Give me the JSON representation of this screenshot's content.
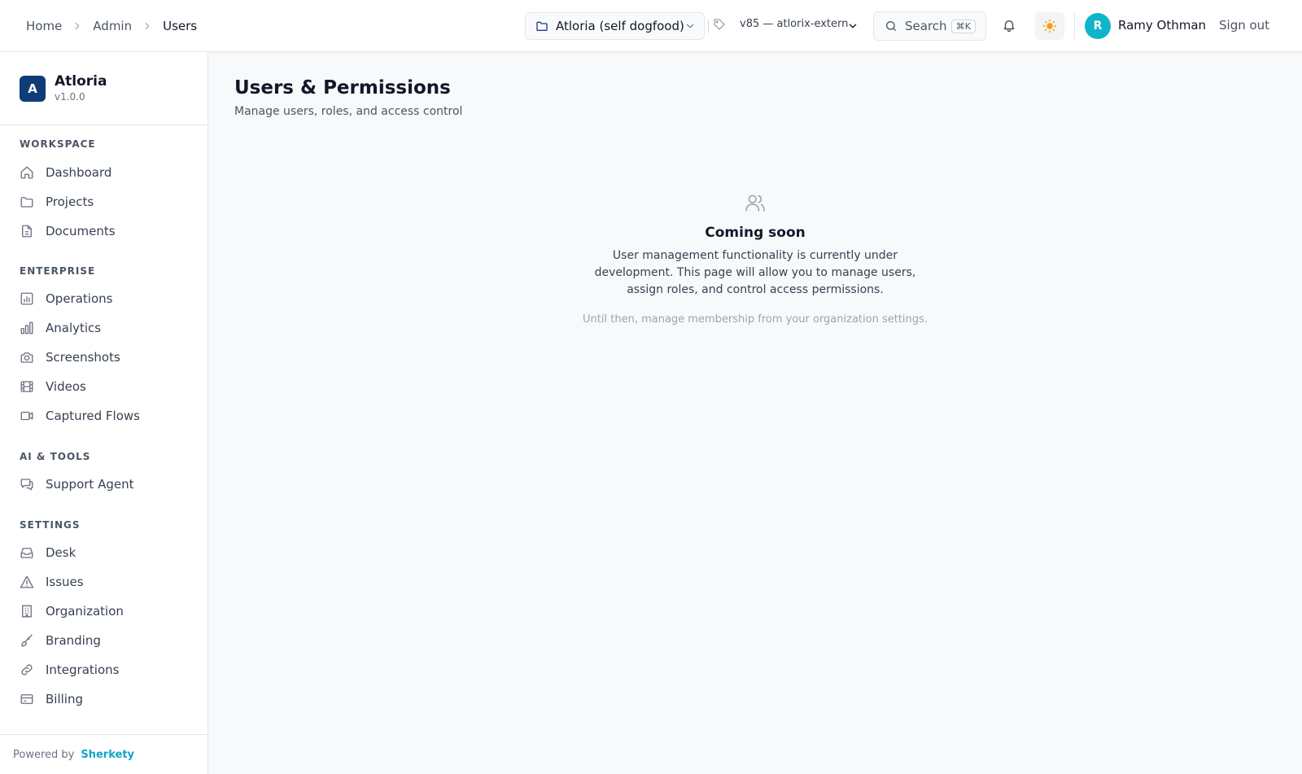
{
  "breadcrumb": {
    "items": [
      "Home",
      "Admin",
      "Users"
    ]
  },
  "header": {
    "project_label": "Atloria (self dogfood)",
    "version_label": "v85 — atlorix-extern",
    "search_label": "Search",
    "search_shortcut": "⌘K",
    "user_initial": "R",
    "user_name": "Ramy Othman",
    "signout_label": "Sign out"
  },
  "brand": {
    "logo_letter": "A",
    "name": "Atloria",
    "version": "v1.0.0"
  },
  "sidebar": {
    "sections": [
      {
        "title": "WORKSPACE",
        "items": [
          {
            "label": "Dashboard",
            "icon": "home-icon"
          },
          {
            "label": "Projects",
            "icon": "folder-icon"
          },
          {
            "label": "Documents",
            "icon": "document-icon"
          }
        ]
      },
      {
        "title": "ENTERPRISE",
        "items": [
          {
            "label": "Operations",
            "icon": "operations-icon"
          },
          {
            "label": "Analytics",
            "icon": "bar-chart-icon"
          },
          {
            "label": "Screenshots",
            "icon": "camera-icon"
          },
          {
            "label": "Videos",
            "icon": "film-icon"
          },
          {
            "label": "Captured Flows",
            "icon": "video-camera-icon"
          }
        ]
      },
      {
        "title": "AI & TOOLS",
        "items": [
          {
            "label": "Support Agent",
            "icon": "chat-icon"
          }
        ]
      },
      {
        "title": "SETTINGS",
        "items": [
          {
            "label": "Desk",
            "icon": "inbox-icon"
          },
          {
            "label": "Issues",
            "icon": "warning-icon"
          },
          {
            "label": "Organization",
            "icon": "building-icon"
          },
          {
            "label": "Branding",
            "icon": "brush-icon"
          },
          {
            "label": "Integrations",
            "icon": "link-icon"
          },
          {
            "label": "Billing",
            "icon": "credit-card-icon"
          }
        ]
      }
    ],
    "footer": {
      "powered_by": "Powered by",
      "brand": "Sherkety"
    }
  },
  "main": {
    "title": "Users & Permissions",
    "subtitle": "Manage users, roles, and access control",
    "empty_state": {
      "icon": "users-icon",
      "title": "Coming soon",
      "description": "User management functionality is currently under development. This page will allow you to manage users, assign roles, and control access permissions.",
      "note": "Until then, manage membership from your organization settings."
    }
  },
  "colors": {
    "accent": "#0fb5c9",
    "brand_logo": "#0f3b78",
    "sun": "#f59e0b",
    "link": "#0ea5c6"
  }
}
